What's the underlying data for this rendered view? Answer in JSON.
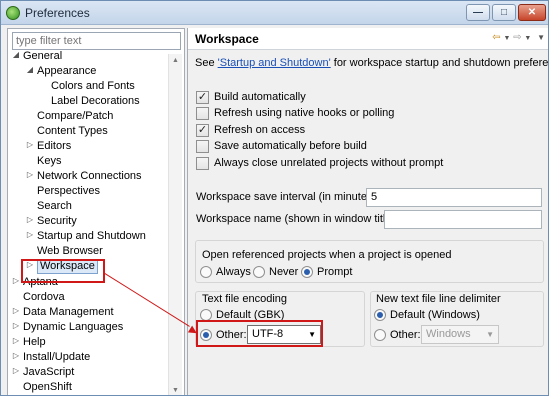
{
  "window": {
    "title": "Preferences",
    "min_glyph": "—",
    "max_glyph": "□",
    "close_glyph": "✕"
  },
  "filter": {
    "placeholder": "type filter text"
  },
  "tree": {
    "items": [
      {
        "label": "General"
      },
      {
        "label": "Appearance"
      },
      {
        "label": "Colors and Fonts"
      },
      {
        "label": "Label Decorations"
      },
      {
        "label": "Compare/Patch"
      },
      {
        "label": "Content Types"
      },
      {
        "label": "Editors"
      },
      {
        "label": "Keys"
      },
      {
        "label": "Network Connections"
      },
      {
        "label": "Perspectives"
      },
      {
        "label": "Search"
      },
      {
        "label": "Security"
      },
      {
        "label": "Startup and Shutdown"
      },
      {
        "label": "Web Browser"
      },
      {
        "label": "Workspace"
      },
      {
        "label": "Aptana"
      },
      {
        "label": "Cordova"
      },
      {
        "label": "Data Management"
      },
      {
        "label": "Dynamic Languages"
      },
      {
        "label": "Help"
      },
      {
        "label": "Install/Update"
      },
      {
        "label": "JavaScript"
      },
      {
        "label": "OpenShift"
      }
    ]
  },
  "page": {
    "title": "Workspace",
    "desc_prefix": "See ",
    "desc_link": "'Startup and Shutdown'",
    "desc_suffix": " for workspace startup and shutdown preferences.",
    "checkboxes": [
      {
        "label": "Build automatically",
        "checked": true
      },
      {
        "label": "Refresh using native hooks or polling",
        "checked": false
      },
      {
        "label": "Refresh on access",
        "checked": true
      },
      {
        "label": "Save automatically before build",
        "checked": false
      },
      {
        "label": "Always close unrelated projects without prompt",
        "checked": false
      }
    ],
    "save_interval_label": "Workspace save interval (in minutes):",
    "save_interval_value": "5",
    "workspace_name_label": "Workspace name (shown in window title):",
    "workspace_name_value": "",
    "open_projects": {
      "title": "Open referenced projects when a project is opened",
      "options": [
        "Always",
        "Never",
        "Prompt"
      ],
      "selected": "Prompt"
    },
    "encoding": {
      "title": "Text file encoding",
      "default_label": "Default (GBK)",
      "other_label": "Other:",
      "other_value": "UTF-8",
      "selected": "Other"
    },
    "line_delimiter": {
      "title": "New text file line delimiter",
      "default_label": "Default (Windows)",
      "other_label": "Other:",
      "other_value": "Windows",
      "selected": "Default"
    }
  },
  "accent_colors": {
    "annotation": "#d01818",
    "selection": "#dbe8f8",
    "link": "#1a4fb5"
  }
}
